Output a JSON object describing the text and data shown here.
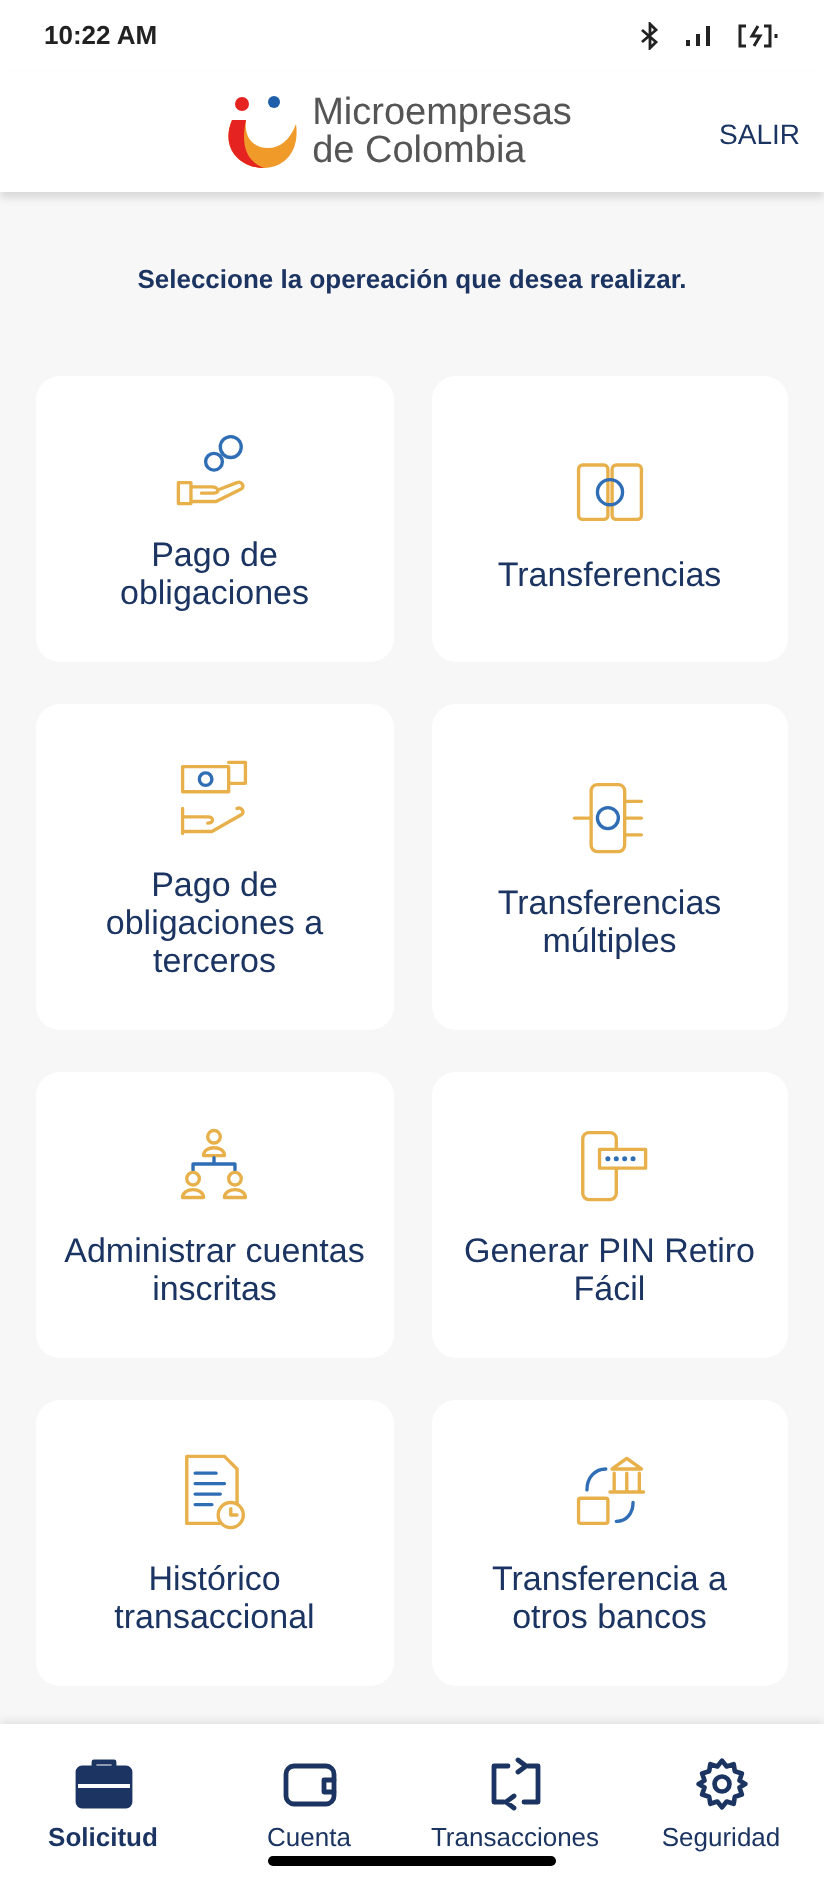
{
  "status_bar": {
    "time": "10:22 AM"
  },
  "header": {
    "logo_line_1": "Microempresas",
    "logo_line_2": "de Colombia",
    "action": "SALIR"
  },
  "instruction": "Seleccione la opereación que desea realizar.",
  "operations": [
    {
      "label": "Pago de obligaciones",
      "kind": "hand-coins"
    },
    {
      "label": "Transferencias",
      "kind": "phones"
    },
    {
      "label": "Pago de obligaciones a terceros",
      "kind": "hand-bill"
    },
    {
      "label": "Transferencias múltiples",
      "kind": "phone-multi"
    },
    {
      "label": "Administrar cuentas inscritas",
      "kind": "people"
    },
    {
      "label": "Generar PIN Retiro Fácil",
      "kind": "phone-pin"
    },
    {
      "label": "Histórico transaccional",
      "kind": "document-clock"
    },
    {
      "label": "Transferencia a otros bancos",
      "kind": "bank-wallet"
    }
  ],
  "bottom_nav": [
    {
      "label": "Solicitud",
      "kind": "briefcase",
      "selected": true
    },
    {
      "label": "Cuenta",
      "kind": "wallet",
      "selected": false
    },
    {
      "label": "Transacciones",
      "kind": "swap",
      "selected": false
    },
    {
      "label": "Seguridad",
      "kind": "gear",
      "selected": false
    }
  ]
}
